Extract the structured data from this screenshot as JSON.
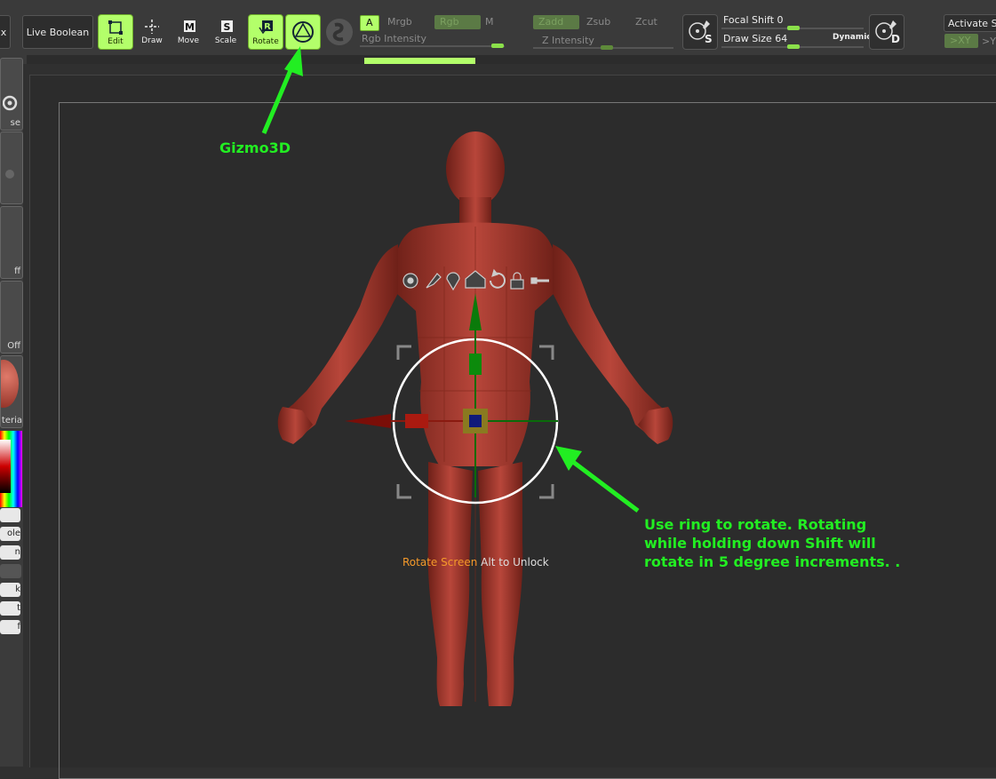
{
  "toolbar": {
    "x_label": "x",
    "live_boolean": "Live Boolean",
    "modes": [
      {
        "label": "Edit",
        "active": true
      },
      {
        "label": "Draw",
        "active": false
      },
      {
        "label": "Move",
        "active": false
      },
      {
        "label": "Scale",
        "active": false
      },
      {
        "label": "Rotate",
        "active": true
      }
    ],
    "gizmo_active": true,
    "rgb_group": {
      "a": "A",
      "mrgb": "Mrgb",
      "rgb": "Rgb",
      "m": "M",
      "intensity": "Rgb Intensity"
    },
    "z_group": {
      "zadd": "Zadd",
      "zsub": "Zsub",
      "zcut": "Zcut",
      "intensity": "Z Intensity"
    },
    "brush_s_label": "S",
    "focal_shift": "Focal Shift 0",
    "draw_size": "Draw Size 64",
    "dynamic": "Dynamic",
    "brush_d_label": "D",
    "activate": "Activate Sy",
    "xyz": ">XY",
    "y": ">Y"
  },
  "leftpanel": {
    "labels": [
      "se",
      "ff",
      "Off",
      "teria",
      "ole",
      "n",
      "k",
      "t",
      "f"
    ]
  },
  "viewport": {
    "hint_orange": "Rotate Screen",
    "hint_white": " Alt to Unlock"
  },
  "annotations": {
    "gizmo": "Gizmo3D",
    "ring": "Use ring to rotate. Rotating while holding down Shift will rotate in 5 degree increments. ."
  },
  "colors": {
    "accent": "#b3ff6a",
    "annotation": "#22ee22",
    "model": "#a83a2e",
    "hint_orange": "#f59a2a"
  }
}
